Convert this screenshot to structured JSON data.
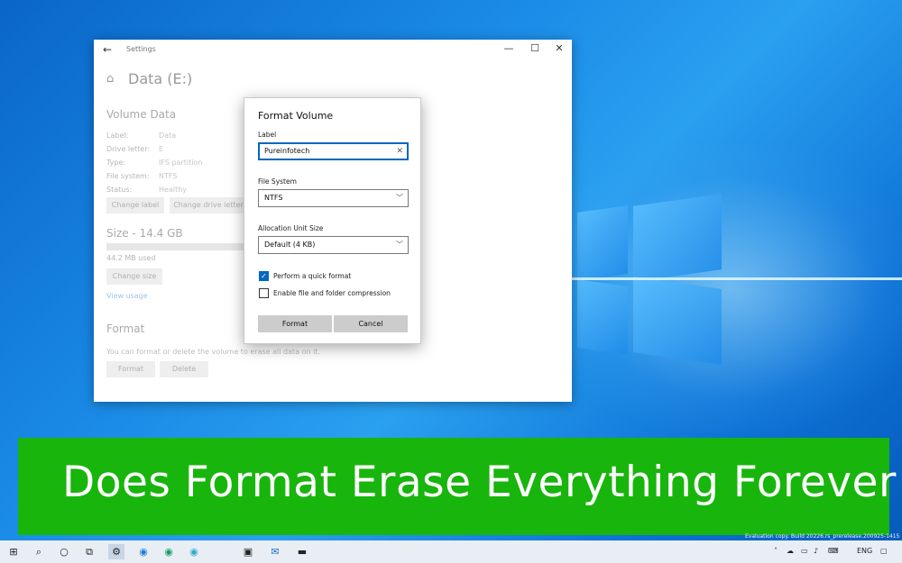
{
  "settings_window": {
    "title": "Settings",
    "page_title": "Data (E:)",
    "volume_section": {
      "heading": "Volume Data",
      "rows": [
        {
          "label": "Label:",
          "value": "Data"
        },
        {
          "label": "Drive letter:",
          "value": "E"
        },
        {
          "label": "Type:",
          "value": "IFS partition"
        },
        {
          "label": "File system:",
          "value": "NTFS"
        },
        {
          "label": "Status:",
          "value": "Healthy"
        }
      ],
      "change_label_button": "Change label",
      "change_drive_letter_button": "Change drive letter"
    },
    "size_section": {
      "heading": "Size - 14.4 GB",
      "used_text": "44.2 MB used",
      "used_fraction": 0.003,
      "change_size_button": "Change size",
      "view_usage_link": "View usage"
    },
    "format_section": {
      "heading": "Format",
      "description": "You can format or delete the volume to erase all data on it.",
      "format_button": "Format",
      "delete_button": "Delete"
    }
  },
  "format_dialog": {
    "title": "Format Volume",
    "label_field_label": "Label",
    "label_value": "Pureinfotech",
    "file_system_label": "File System",
    "file_system_value": "NTFS",
    "allocation_label": "Allocation Unit Size",
    "allocation_value": "Default (4 KB)",
    "quick_format_label": "Perform a quick format",
    "quick_format_checked": true,
    "compression_label": "Enable file and folder compression",
    "compression_checked": false,
    "format_button": "Format",
    "cancel_button": "Cancel"
  },
  "banner": {
    "text": "Does Format Erase Everything Forever",
    "color": "#18b50c"
  },
  "watermark": {
    "line": "Evaluation copy. Build 20226.rs_prerelease.200925-1415"
  },
  "taskbar": {
    "language": "ENG",
    "icons": [
      "windows-icon",
      "search-icon",
      "task-view-icon",
      "widgets-icon",
      "settings-icon",
      "edge-icon",
      "edge-dev-icon",
      "edge-beta-icon",
      "store-icon",
      "mail-icon",
      "terminal-icon"
    ]
  }
}
